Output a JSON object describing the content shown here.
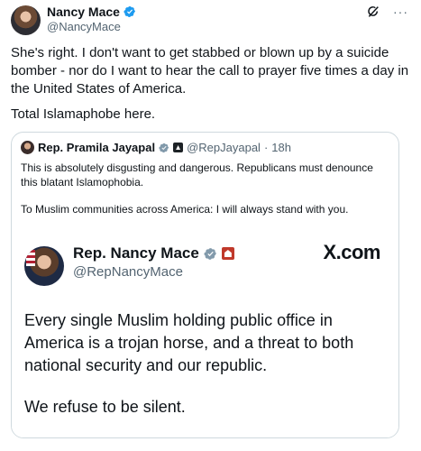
{
  "author": {
    "name": "Nancy Mace",
    "handle": "@NancyMace"
  },
  "tweet": {
    "text": "She's right. I don't want to get stabbed or blown up by a suicide bomber - nor do I want to hear the call to prayer five times a day in the United States of America.",
    "text_line2": "Total Islamaphobe here."
  },
  "top_icons": {
    "grok": "grok-icon",
    "more": "···"
  },
  "quote": {
    "name": "Rep. Pramila Jayapal",
    "handle": "@RepJayapal",
    "separator": "·",
    "time": "18h",
    "text": "This is absolutely disgusting and dangerous. Republicans must denounce this blatant Islamophobia.",
    "text2": "To Muslim communities across America: I will always stand with you."
  },
  "image_card": {
    "name": "Rep. Nancy Mace",
    "handle": "@RepNancyMace",
    "brand": "X.com",
    "body": "Every single Muslim holding public office in America is a trojan horse, and a threat to both national security and our republic.",
    "body2": "We refuse to be silent."
  },
  "colors": {
    "verified_blue": "#1d9bf0",
    "text": "#0f1419",
    "secondary": "#536471",
    "border": "#cfd9de"
  }
}
